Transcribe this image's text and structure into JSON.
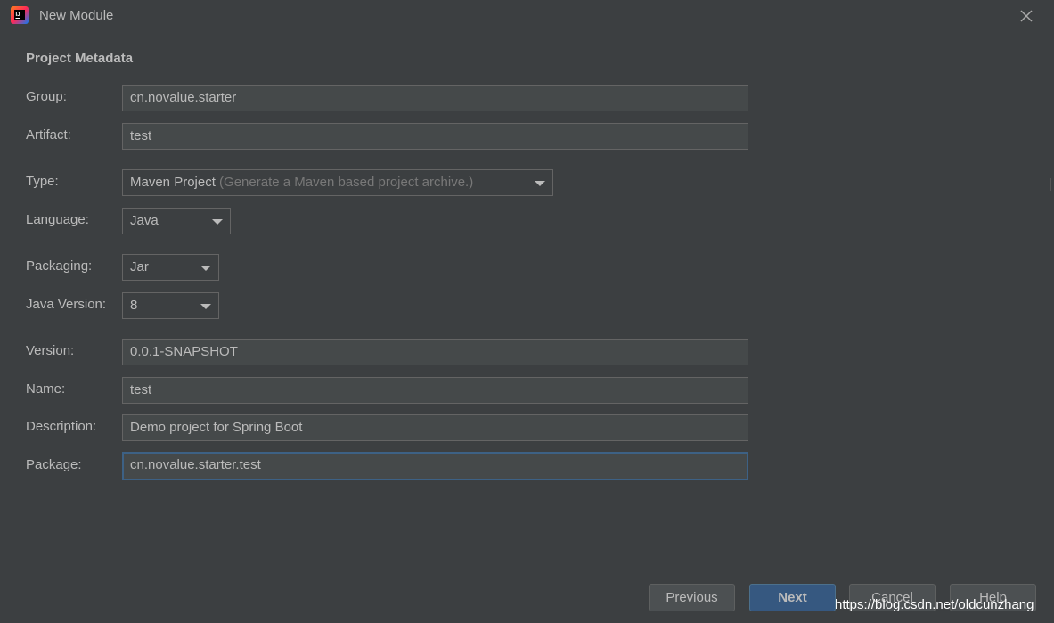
{
  "window": {
    "title": "New Module",
    "icon": "intellij-idea-icon",
    "close": "close-icon"
  },
  "section_title": "Project Metadata",
  "fields": {
    "group": {
      "label": "Group:",
      "value": "cn.novalue.starter"
    },
    "artifact": {
      "label": "Artifact:",
      "value": "test"
    },
    "type": {
      "label": "Type:",
      "value": "Maven Project",
      "hint": "(Generate a Maven based project archive.)"
    },
    "language": {
      "label": "Language:",
      "value": "Java"
    },
    "packaging": {
      "label": "Packaging:",
      "value": "Jar"
    },
    "java_version": {
      "label": "Java Version:",
      "value": "8"
    },
    "version": {
      "label": "Version:",
      "value": "0.0.1-SNAPSHOT"
    },
    "name": {
      "label": "Name:",
      "value": "test"
    },
    "description": {
      "label": "Description:",
      "value": "Demo project for Spring Boot"
    },
    "package": {
      "label": "Package:",
      "value": "cn.novalue.starter.test"
    }
  },
  "buttons": {
    "previous": "Previous",
    "next": "Next",
    "cancel": "Cancel",
    "help": "Help"
  },
  "watermark": "https://blog.csdn.net/oldcunzhang",
  "colors": {
    "background": "#3c3f41",
    "field_bg": "#45494a",
    "focus_border": "#3d6185",
    "default_button": "#365880",
    "text": "#bbbbbb"
  }
}
